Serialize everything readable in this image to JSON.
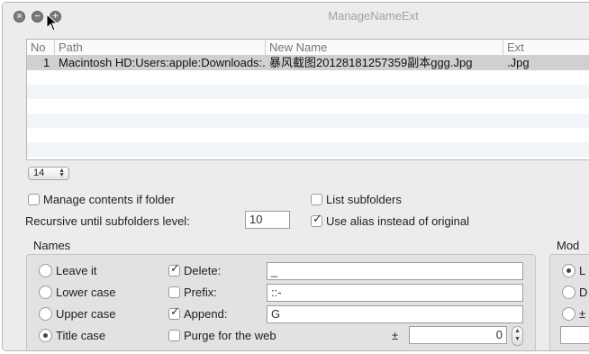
{
  "window": {
    "title": "ManageNameExt"
  },
  "table": {
    "headers": {
      "no": "No",
      "path": "Path",
      "new_name": "New Name",
      "ext": "Ext"
    },
    "rows": [
      {
        "no": "1",
        "path": "Macintosh HD:Users:apple:Downloads:...",
        "new_name": "暴风截图20128181257359副本ggg.Jpg",
        "ext": ".Jpg"
      }
    ]
  },
  "font_size_popup": {
    "value": "14"
  },
  "options": {
    "manage_contents_label": "Manage contents if folder",
    "list_subfolders_label": "List subfolders",
    "recursive_label": "Recursive until subfolders level:",
    "recursive_value": "10",
    "use_alias_label": "Use alias instead of original",
    "use_alias_checked": true
  },
  "names": {
    "title": "Names",
    "radios": [
      "Leave it",
      "Lower case",
      "Upper case",
      "Title case"
    ],
    "selected": "Title case",
    "delete_label": "Delete:",
    "delete_value": "_",
    "prefix_label": "Prefix:",
    "prefix_value": "::-",
    "append_label": "Append:",
    "append_value": "G",
    "purge_label": "Purge for the web",
    "plusminus": "±",
    "number_value": "0"
  },
  "mod": {
    "title": "Mod",
    "radio_labels": [
      "L",
      "D",
      "±"
    ]
  }
}
